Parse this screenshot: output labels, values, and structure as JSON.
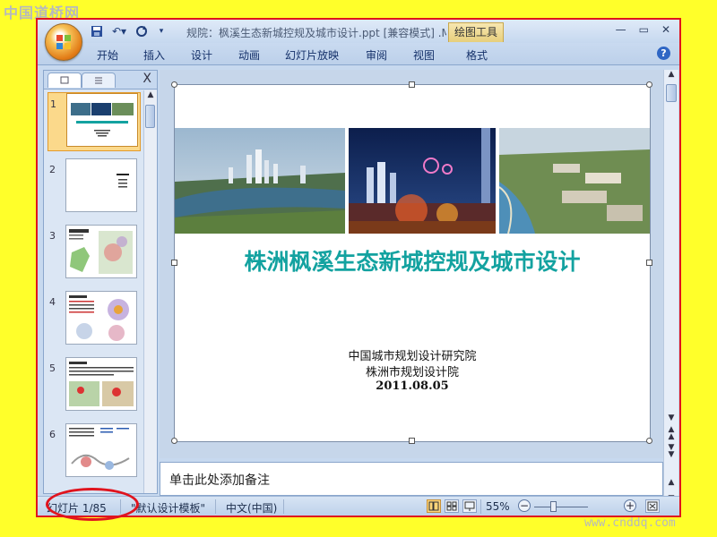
{
  "watermark": {
    "top": "中国道桥网",
    "bottom": "www.cnddq.com"
  },
  "window": {
    "title": "规院：枫溪生态新城控规及城市设计.ppt [兼容模式] .M",
    "context_tab": "绘图工具",
    "controls": [
      "—",
      "▭",
      "✕"
    ],
    "qat_icons": [
      "save-icon",
      "undo-icon",
      "redo-icon",
      "customize-icon"
    ]
  },
  "ribbon": {
    "tabs": [
      "开始",
      "插入",
      "设计",
      "动画",
      "幻灯片放映",
      "审阅",
      "视图",
      "格式"
    ],
    "help_label": "?"
  },
  "left_panel": {
    "close_label": "X",
    "slide_numbers": [
      "1",
      "2",
      "3",
      "4",
      "5",
      "6"
    ],
    "selected_index": 0
  },
  "slide": {
    "title": "株洲枫溪生态新城控规及城市设计",
    "line1": "中国城市规划设计研究院",
    "line2": "株洲市规划设计院",
    "date": "2011.08.05"
  },
  "notes": {
    "placeholder": "单击此处添加备注"
  },
  "status": {
    "slide_info": "幻灯片 1/85",
    "template": "\"默认设计模板\"",
    "language": "中文(中国)",
    "zoom": "55%",
    "zoom_minus": "−",
    "zoom_plus": "+"
  },
  "colors": {
    "title_teal": "#13a2a0",
    "highlight_red": "#e0141e",
    "background_yellow": "#ffff2a",
    "ribbon_blue": "#c6d8ef"
  }
}
